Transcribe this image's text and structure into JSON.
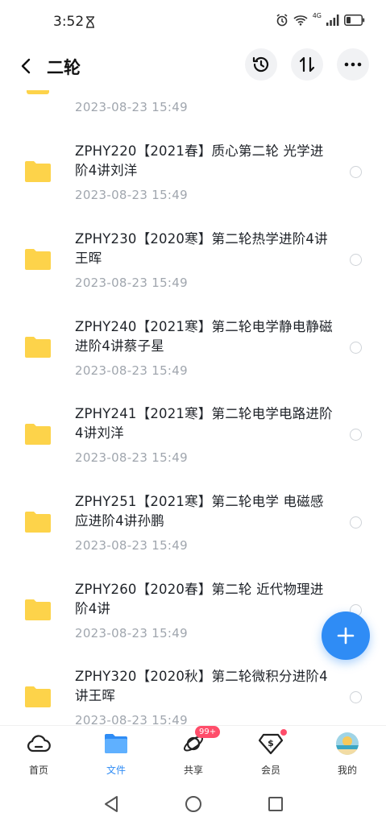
{
  "status_bar": {
    "time": "3:52",
    "network": "4G"
  },
  "header": {
    "title": "二轮"
  },
  "partial_item": {
    "date": "2023-08-23  15:49"
  },
  "files": [
    {
      "name": "ZPHY220【2021春】质心第二轮 光学进阶4讲刘洋",
      "date": "2023-08-23  15:49"
    },
    {
      "name": "ZPHY230【2020寒】第二轮热学进阶4讲王晖",
      "date": "2023-08-23  15:49"
    },
    {
      "name": "ZPHY240【2021寒】第二轮电学静电静磁进阶4讲蔡子星",
      "date": "2023-08-23  15:49"
    },
    {
      "name": "ZPHY241【2021寒】第二轮电学电路进阶4讲刘洋",
      "date": "2023-08-23  15:49"
    },
    {
      "name": "ZPHY251【2021寒】第二轮电学 电磁感应进阶4讲孙鹏",
      "date": "2023-08-23  15:49"
    },
    {
      "name": "ZPHY260【2020春】第二轮 近代物理进阶4讲",
      "date": "2023-08-23  15:49"
    },
    {
      "name": "ZPHY320【2020秋】第二轮微积分进阶4讲王晖",
      "date": "2023-08-23  15:49"
    }
  ],
  "bottom_nav": {
    "home": "首页",
    "files": "文件",
    "share": "共享",
    "share_badge": "99+",
    "member": "会员",
    "mine": "我的"
  },
  "colors": {
    "accent": "#2f8cf5",
    "folder": "#fdd34a",
    "badge": "#ff4d6a"
  }
}
